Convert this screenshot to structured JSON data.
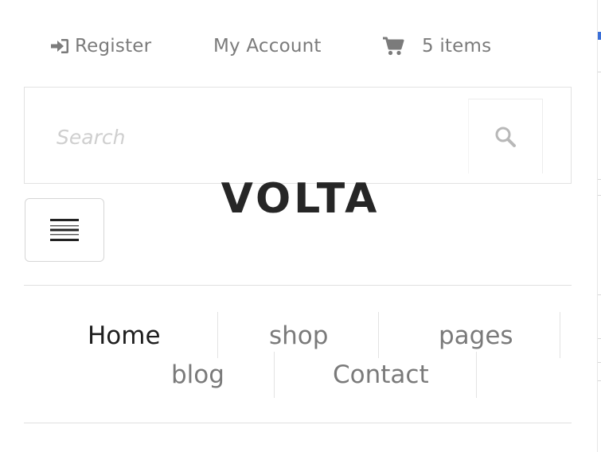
{
  "header": {
    "register_label": "Register",
    "account_label": "My Account",
    "cart_label": "5 items"
  },
  "search": {
    "placeholder": "Search"
  },
  "logo": {
    "text": "VOLTA"
  },
  "nav": {
    "items": [
      {
        "label": "Home",
        "active": true
      },
      {
        "label": "shop",
        "active": false
      },
      {
        "label": "pages",
        "active": false
      },
      {
        "label": "blog",
        "active": false
      },
      {
        "label": "Contact",
        "active": false
      }
    ]
  },
  "icons": {
    "register": "sign-in-icon",
    "cart": "shopping-cart-icon",
    "search": "magnifier-icon",
    "menu": "hamburger-icon"
  },
  "colors": {
    "text_muted": "#7a7a7a",
    "text_active": "#1e1e1e",
    "logo": "#262626",
    "border": "#e2e2e2"
  }
}
